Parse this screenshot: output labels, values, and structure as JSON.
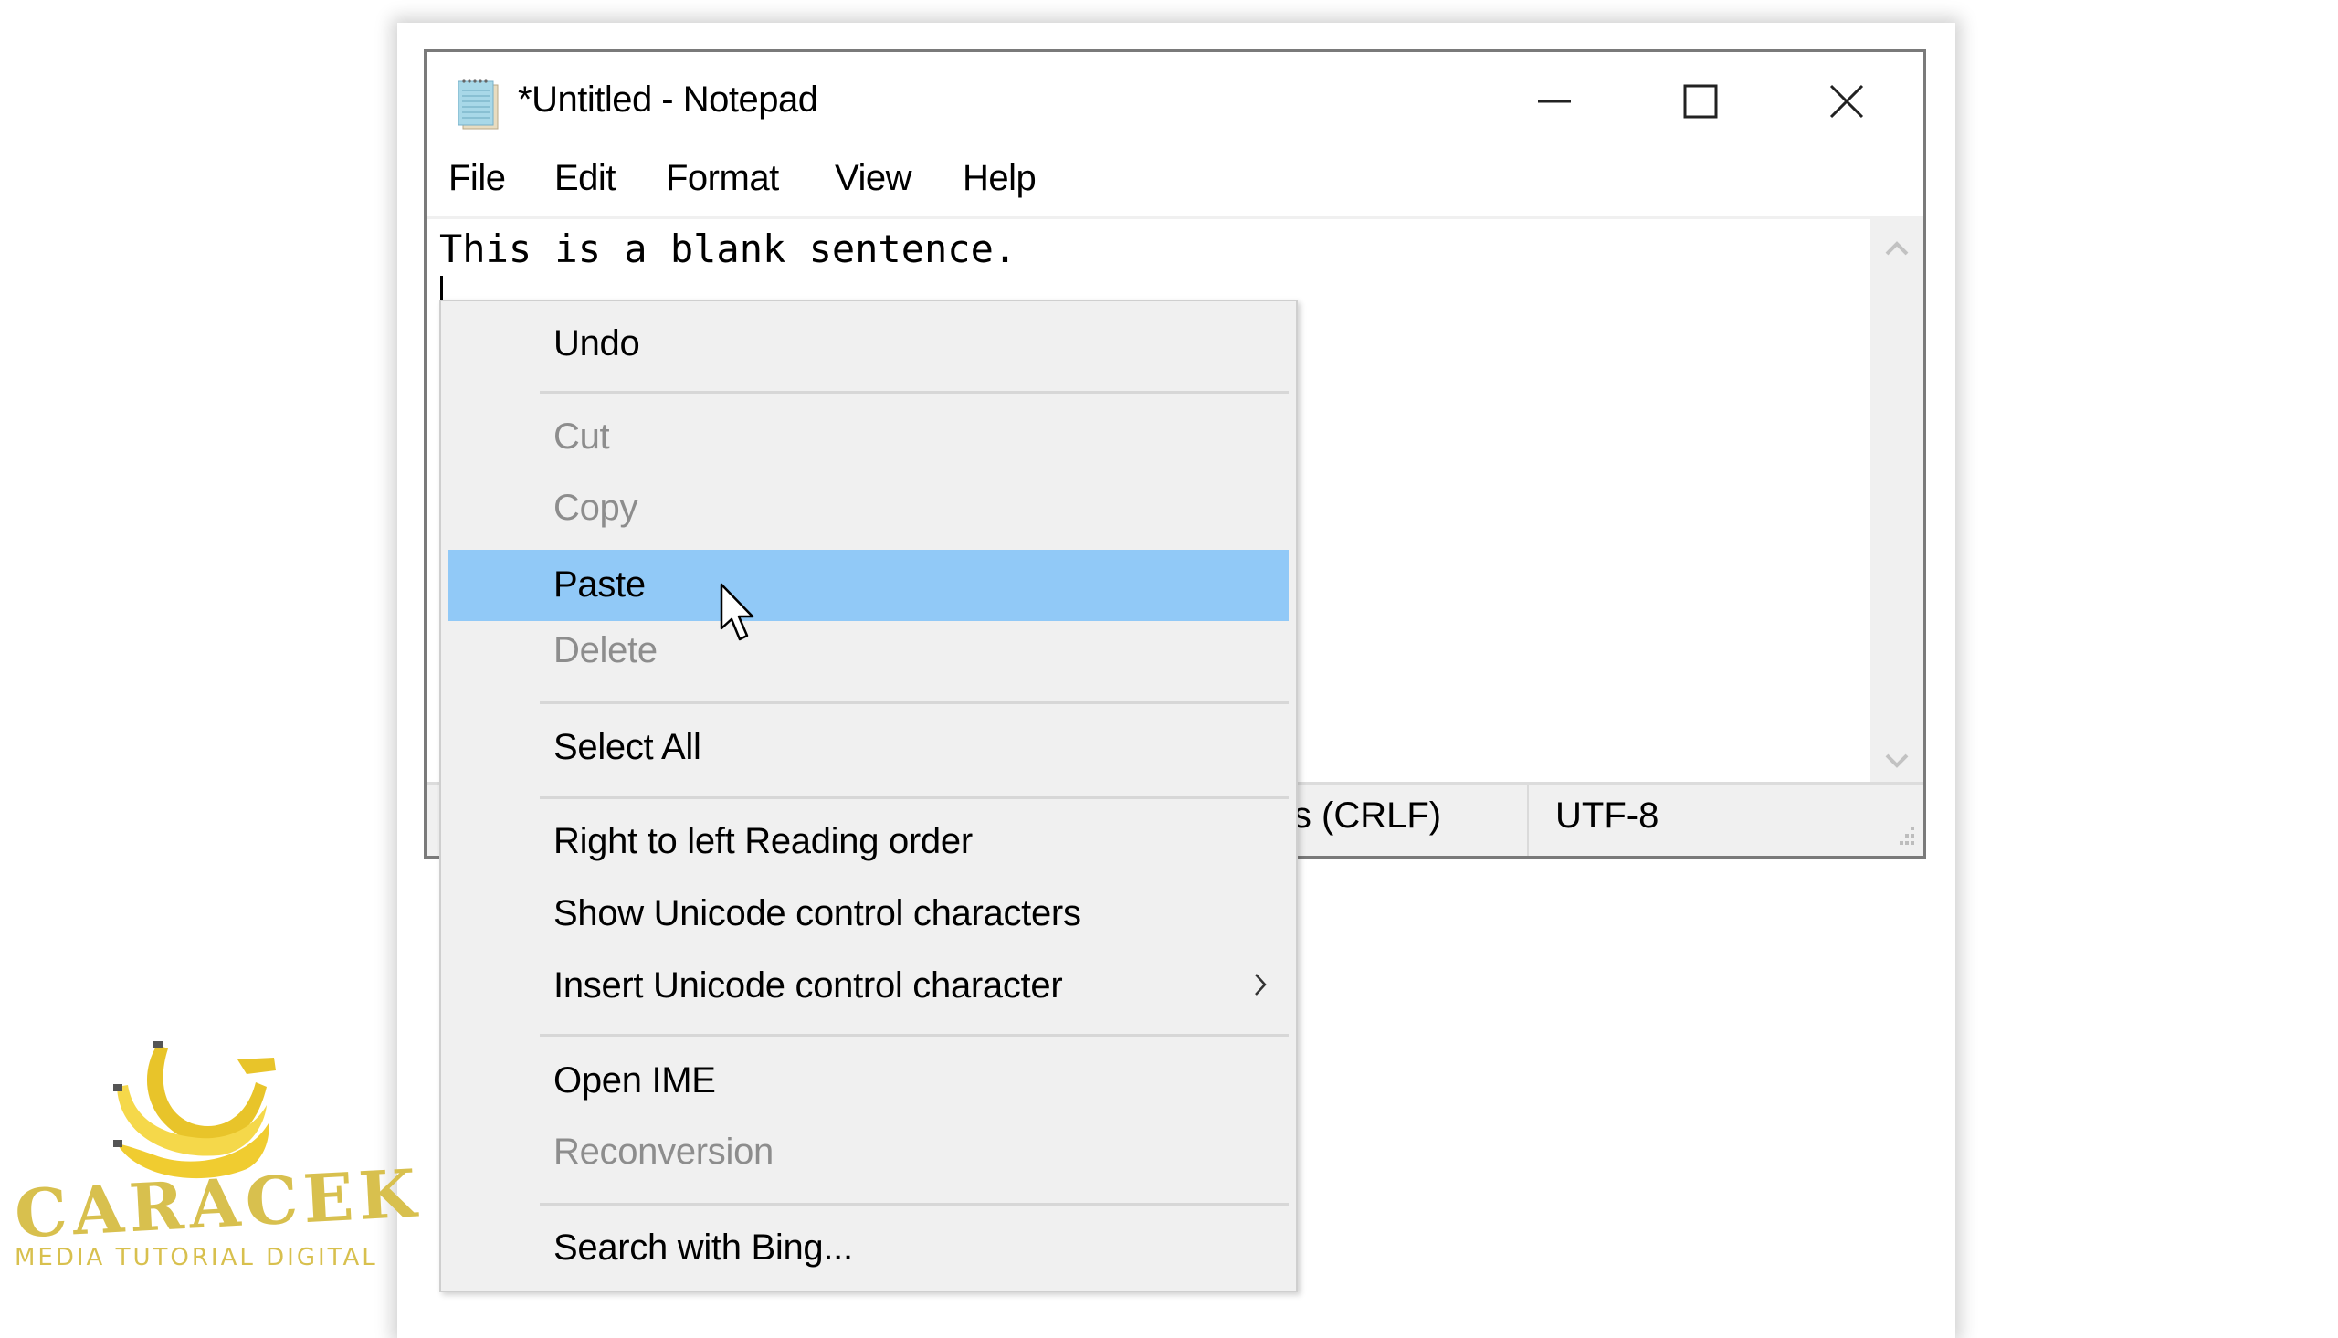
{
  "window": {
    "title": "*Untitled - Notepad",
    "app_icon": "notepad-icon",
    "controls": {
      "minimize": "minimize-icon",
      "maximize": "maximize-icon",
      "close": "close-icon"
    }
  },
  "menubar": {
    "items": [
      {
        "label": "File"
      },
      {
        "label": "Edit"
      },
      {
        "label": "Format"
      },
      {
        "label": "View"
      },
      {
        "label": "Help"
      }
    ]
  },
  "editor": {
    "content": "This is a blank sentence."
  },
  "statusbar": {
    "line_ending": "ws (CRLF)",
    "encoding": "UTF-8"
  },
  "context_menu": {
    "items": [
      {
        "label": "Undo",
        "enabled": true
      },
      {
        "label": "Cut",
        "enabled": false
      },
      {
        "label": "Copy",
        "enabled": false
      },
      {
        "label": "Paste",
        "enabled": true,
        "highlighted": true
      },
      {
        "label": "Delete",
        "enabled": false
      },
      {
        "label": "Select All",
        "enabled": true
      },
      {
        "label": "Right to left Reading order",
        "enabled": true
      },
      {
        "label": "Show Unicode control characters",
        "enabled": true
      },
      {
        "label": "Insert Unicode control character",
        "enabled": true,
        "submenu": true
      },
      {
        "label": "Open IME",
        "enabled": true
      },
      {
        "label": "Reconversion",
        "enabled": false
      },
      {
        "label": "Search with Bing...",
        "enabled": true
      }
    ],
    "highlight_color": "#91c9f7"
  },
  "watermark": {
    "title": "CARACEK",
    "subtitle": "MEDIA TUTORIAL DIGITAL",
    "color": "#d8c04e"
  }
}
